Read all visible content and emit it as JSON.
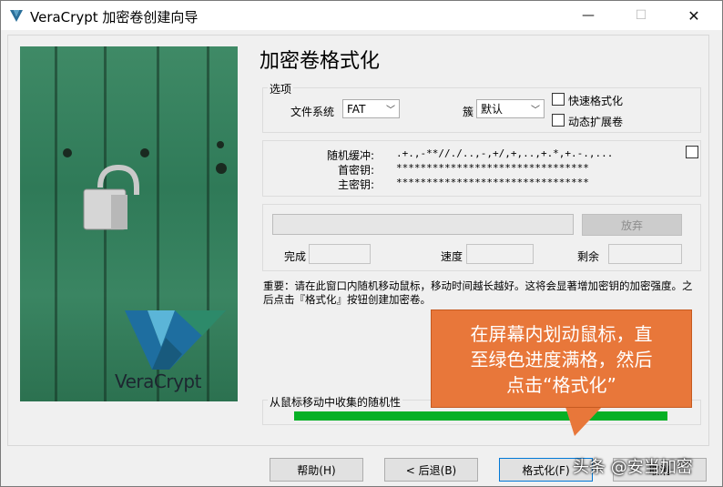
{
  "window": {
    "title": "VeraCrypt 加密卷创建向导",
    "minimize_glyph": "—",
    "maximize_glyph": "☐",
    "close_glyph": "✕"
  },
  "side_image": {
    "brand": "VeraCrypt"
  },
  "page": {
    "title": "加密卷格式化"
  },
  "options": {
    "legend": "选项",
    "filesystem_label": "文件系统",
    "filesystem_value": "FAT",
    "cluster_label": "簇",
    "cluster_value": "默认",
    "quick_format_label": "快速格式化",
    "dynamic_label": "动态扩展卷"
  },
  "keys": {
    "random_pool_label": "随机缓冲:",
    "random_pool_value": ".+.,-**//./..,-,+/,+,..,+.*,+.-.,...",
    "header_key_label": "首密钥:",
    "header_key_value": "********************************",
    "master_key_label": "主密钥:",
    "master_key_value": "********************************"
  },
  "progress": {
    "abort_label": "放弃",
    "done_label": "完成",
    "speed_label": "速度",
    "remaining_label": "剩余"
  },
  "notice": "重要：请在此窗口内随机移动鼠标，移动时间越长越好。这将会显著增加密钥的加密强度。之后点击『格式化』按钮创建加密卷。",
  "entropy": {
    "legend": "从鼠标移动中收集的随机性",
    "fill_fraction": 1.0,
    "fill_color": "#06b025"
  },
  "callout": {
    "line1": "在屏幕内划动鼠标，直",
    "line2": "至绿色进度满格，然后",
    "line3": "点击“格式化”",
    "color": "#e8773a"
  },
  "buttons": {
    "help": "帮助(H)",
    "back": "< 后退(B)",
    "format": "格式化(F)",
    "cancel": "取消"
  },
  "watermark": "头条 @安当加密"
}
